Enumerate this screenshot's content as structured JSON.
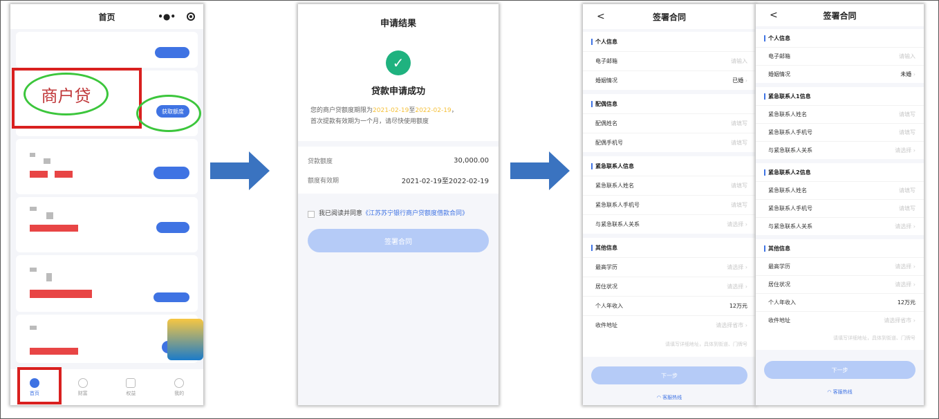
{
  "home": {
    "title": "首页",
    "menu_icon": "more-dots-icon",
    "close_icon": "target-icon",
    "annotation_text": "商户贷",
    "get_quota_button": "获取额度",
    "tabs": [
      {
        "label": "首页",
        "active": true
      },
      {
        "label": "财富"
      },
      {
        "label": "权益"
      },
      {
        "label": "我的"
      }
    ],
    "annotation_colors": {
      "box": "#d9201f",
      "circle": "#3cc63c"
    }
  },
  "result": {
    "title": "申请结果",
    "status_icon": "check-circle-icon",
    "status": "贷款申请成功",
    "msg_prefix": "您的商户贷额度期限为",
    "date_from": "2021-02-19",
    "msg_mid": "至",
    "date_to": "2022-02-19",
    "msg_suffix": "，",
    "msg_line2": "首次提款有效期为一个月，请尽快使用额度",
    "amount_label": "贷款额度",
    "amount": "30,000.00",
    "validity_label": "额度有效期",
    "validity": "2021-02-19至2022-02-19",
    "agree_prefix": "我已阅读并同意",
    "agree_link": "《江苏苏宁银行商户贷额度借款合同》",
    "sign_button": "签署合同",
    "colors": {
      "success": "#1fb27f",
      "highlight": "#f5c13b",
      "link": "#3f73e3"
    }
  },
  "contract_married": {
    "title": "签署合同",
    "back": "<",
    "sections": [
      {
        "title": "个人信息",
        "rows": [
          {
            "label": "电子邮箱",
            "value": "请输入"
          },
          {
            "label": "婚姻情况",
            "value": "已婚",
            "set": true,
            "chev": true
          }
        ]
      },
      {
        "title": "配偶信息",
        "rows": [
          {
            "label": "配偶姓名",
            "value": "请填写"
          },
          {
            "label": "配偶手机号",
            "value": "请填写"
          }
        ]
      },
      {
        "title": "紧急联系人信息",
        "rows": [
          {
            "label": "紧急联系人姓名",
            "value": "请填写"
          },
          {
            "label": "紧急联系人手机号",
            "value": "请填写"
          },
          {
            "label": "与紧急联系人关系",
            "value": "请选择",
            "chev": true
          }
        ]
      },
      {
        "title": "其他信息",
        "rows": [
          {
            "label": "最高学历",
            "value": "请选择",
            "chev": true
          },
          {
            "label": "居住状况",
            "value": "请选择",
            "chev": true
          },
          {
            "label": "个人年收入",
            "value": "12万元",
            "set": true
          },
          {
            "label": "收件地址",
            "value": "请选择省市",
            "chev": true
          }
        ],
        "hint": "请填写详细地址，具体到街道、门牌号"
      }
    ],
    "next_button": "下一步",
    "hotline": "客服热线"
  },
  "contract_single": {
    "title": "签署合同",
    "back": "<",
    "sections": [
      {
        "title": "个人信息",
        "rows": [
          {
            "label": "电子邮箱",
            "value": "请输入"
          },
          {
            "label": "婚姻情况",
            "value": "未婚",
            "set": true,
            "chev": true
          }
        ]
      },
      {
        "title": "紧急联系人1信息",
        "rows": [
          {
            "label": "紧急联系人姓名",
            "value": "请填写"
          },
          {
            "label": "紧急联系人手机号",
            "value": "请填写"
          },
          {
            "label": "与紧急联系人关系",
            "value": "请选择",
            "chev": true
          }
        ]
      },
      {
        "title": "紧急联系人2信息",
        "rows": [
          {
            "label": "紧急联系人姓名",
            "value": "请填写"
          },
          {
            "label": "紧急联系人手机号",
            "value": "请填写"
          },
          {
            "label": "与紧急联系人关系",
            "value": "请选择",
            "chev": true
          }
        ]
      },
      {
        "title": "其他信息",
        "rows": [
          {
            "label": "最高学历",
            "value": "请选择",
            "chev": true
          },
          {
            "label": "居住状况",
            "value": "请选择",
            "chev": true
          },
          {
            "label": "个人年收入",
            "value": "12万元",
            "set": true
          },
          {
            "label": "收件地址",
            "value": "请选择省市",
            "chev": true
          }
        ],
        "hint": "请填写详细地址，具体到街道、门牌号"
      }
    ],
    "next_button": "下一步",
    "hotline": "客服热线"
  }
}
